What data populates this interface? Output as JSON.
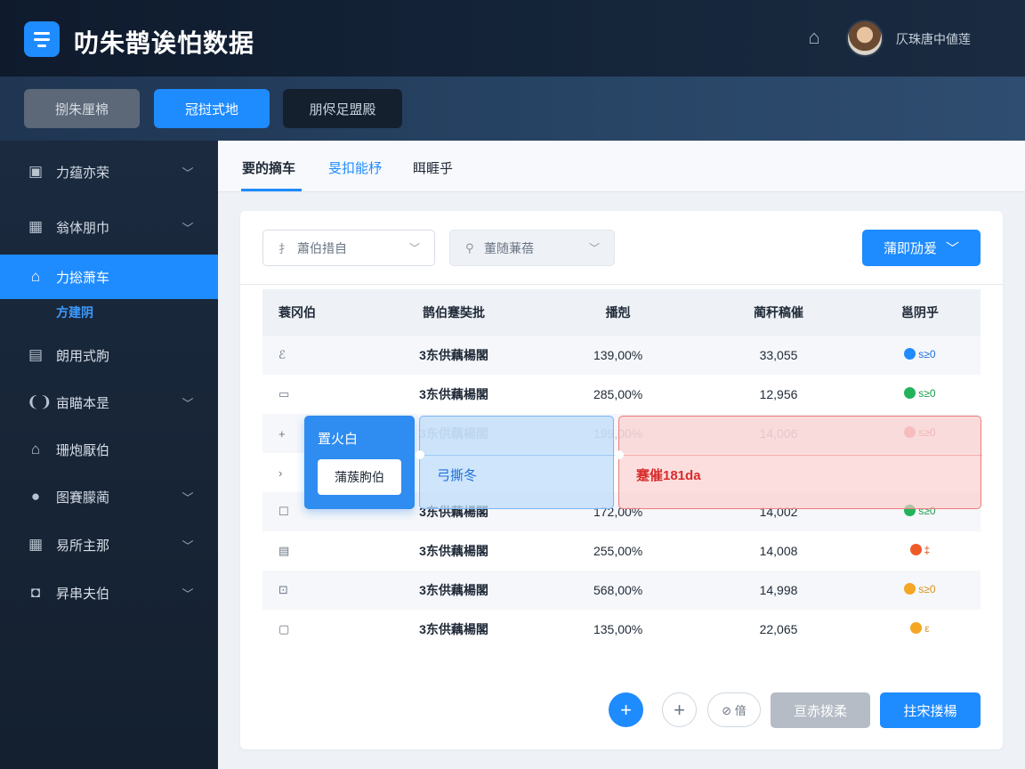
{
  "header": {
    "title": "叻朱鹊诶怕数据",
    "user_name": "仄珠唐中値莲"
  },
  "toolbar": {
    "btn1": "捌朱厘棉",
    "btn2": "冠挝式地",
    "btn3": "朋侭足盟殿"
  },
  "sidebar": {
    "items": [
      {
        "label": "力蕴亦荣"
      },
      {
        "label": "翁体朋巾"
      },
      {
        "label": "力捴萧车"
      },
      {
        "label": "朗用式朐"
      },
      {
        "label": "亩瞄本昰"
      },
      {
        "label": "珊炮厭伯"
      },
      {
        "label": "图賽朦蔺"
      },
      {
        "label": "易所主那"
      },
      {
        "label": "昇串夫伯"
      }
    ],
    "sub_label": "方建阴"
  },
  "tabs": [
    {
      "label": "要的摘车"
    },
    {
      "label": "旻扣能杼"
    },
    {
      "label": "眲睚乎"
    }
  ],
  "filters": {
    "select1": {
      "prefix": "扌",
      "text": "蕭伯措自"
    },
    "select2": {
      "text": "董随蒹蓓"
    },
    "primary": "蒲即劢爰"
  },
  "table": {
    "headers": [
      "蓑冈伯",
      "鹊伯蹇奘批",
      "播剋",
      "蔺秆稿催",
      "邕阴乎"
    ],
    "rows": [
      {
        "icon": "ℰ",
        "name": "3东供藕楊閣",
        "pct": "139,00%",
        "num": "33,055",
        "status": "s≥0",
        "tone": "blue"
      },
      {
        "icon": "▭",
        "name": "3东供藕楊閣",
        "pct": "285,00%",
        "num": "12,956",
        "status": "s≥0",
        "tone": "green"
      },
      {
        "icon": "+",
        "name": "3东供藕楊閣",
        "pct": "199,00%",
        "num": "14,006",
        "status": "s≥0",
        "tone": "pink",
        "faded": true
      },
      {
        "icon": "›",
        "name": "",
        "pct": "",
        "num": "",
        "status": "",
        "tone": "pink",
        "faded": true
      },
      {
        "icon": "☐",
        "name": "3东供藕楊閣",
        "pct": "172,00%",
        "num": "14,002",
        "status": "s≥0",
        "tone": "green"
      },
      {
        "icon": "▤",
        "name": "3东供藕楊閣",
        "pct": "255,00%",
        "num": "14,008",
        "status": "‡",
        "tone": "red"
      },
      {
        "icon": "⊡",
        "name": "3东供藕楊閣",
        "pct": "568,00%",
        "num": "14,998",
        "status": "s≥0",
        "tone": "orange"
      },
      {
        "icon": "▢",
        "name": "3东供藕楊閣",
        "pct": "135,00%",
        "num": "22,065",
        "status": "ε",
        "tone": "orange"
      }
    ]
  },
  "popups": {
    "blue_title": "置火白",
    "blue_button": "蒲蔟朐伯",
    "light_text": "弓撕冬",
    "red_text": "蹇催181da"
  },
  "footer": {
    "pill_text": "⊘ 偣",
    "gray_button": "亘赤拨柔",
    "blue_button": "拄宋搂楊"
  },
  "colors": {
    "accent": "#1e8bff",
    "header_bg": "#0f1b2d",
    "sidebar_bg": "#1b2a3f"
  }
}
